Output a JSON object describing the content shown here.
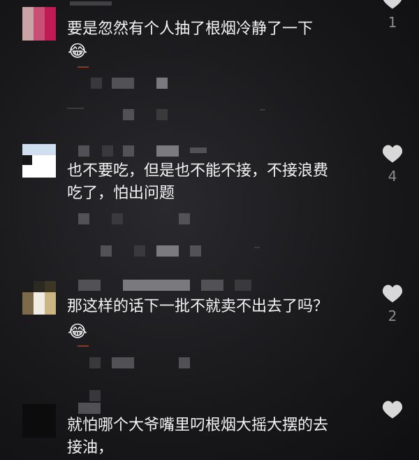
{
  "comments": [
    {
      "text": "要是忽然有个人抽了根烟冷静了一下",
      "likes": "1",
      "has_emoji": true
    },
    {
      "text": "也不要吃，但是也不能不接，不接浪费\n吃了，怕出问题",
      "likes": "4",
      "has_emoji": false
    },
    {
      "text": "那这样的话下一批不就卖不出去了吗？",
      "likes": "2",
      "has_emoji": true
    },
    {
      "text": "就怕哪个大爷嘴里叼根烟大摇大摆的去\n接油，",
      "likes": "",
      "has_emoji": false
    }
  ],
  "emoji": "😂",
  "icons": {
    "like": "heart-icon"
  },
  "colors": {
    "text": "#f4f4f4",
    "muted": "#8c8c8c",
    "heart": "#d8d8d8"
  }
}
